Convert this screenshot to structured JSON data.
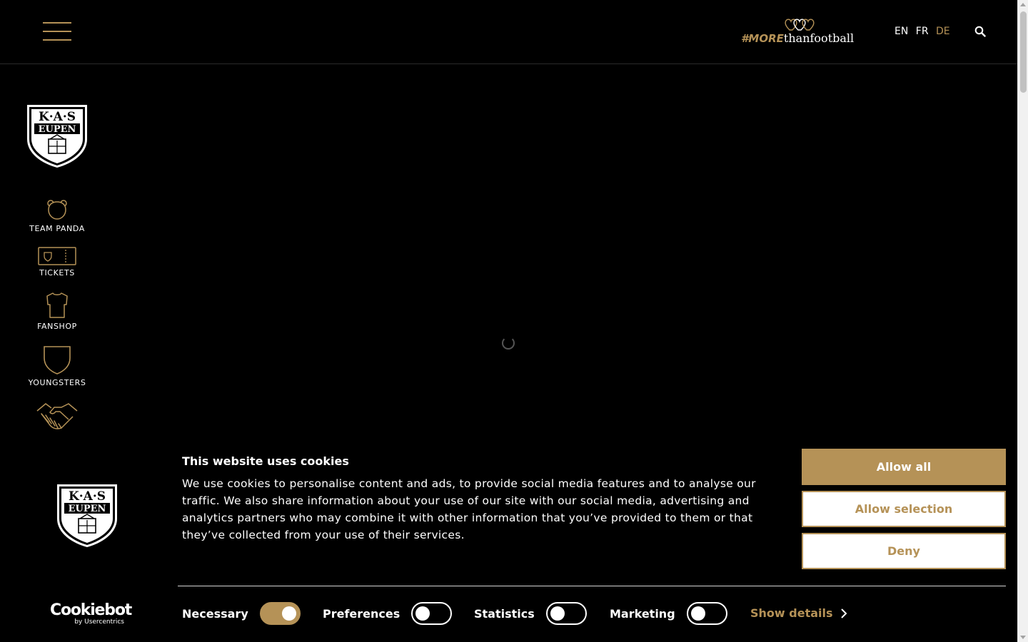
{
  "header": {
    "claim_hash": "#MORE",
    "claim_rest": "thanfootball",
    "languages": [
      {
        "code": "EN",
        "active": false
      },
      {
        "code": "FR",
        "active": false
      },
      {
        "code": "DE",
        "active": true
      }
    ]
  },
  "sidebar": {
    "crest_text_top": "K·A·S",
    "crest_text_bottom": "EUPEN",
    "items": [
      {
        "label": "TEAM PANDA",
        "icon": "panda-icon"
      },
      {
        "label": "TICKETS",
        "icon": "ticket-icon"
      },
      {
        "label": "FANSHOP",
        "icon": "shirt-icon"
      },
      {
        "label": "YOUNGSTERS",
        "icon": "shield-icon"
      },
      {
        "label": "",
        "icon": "handshake-icon"
      }
    ]
  },
  "cookie": {
    "title": "This website uses cookies",
    "body": "We use cookies to personalise content and ads, to provide social media features and to analyse our traffic. We also share information about your use of our site with our social media, advertising and analytics partners who may combine it with other information that you’ve provided to them or that they’ve collected from your use of their services.",
    "buttons": {
      "allow_all": "Allow all",
      "allow_selection": "Allow selection",
      "deny": "Deny"
    },
    "toggles": [
      {
        "label": "Necessary",
        "on": true
      },
      {
        "label": "Preferences",
        "on": false
      },
      {
        "label": "Statistics",
        "on": false
      },
      {
        "label": "Marketing",
        "on": false
      }
    ],
    "show_details": "Show details",
    "brand_main": "Cookiebot",
    "brand_sub": "by Usercentrics"
  },
  "colors": {
    "accent": "#b59257",
    "background": "#000000",
    "text": "#ffffff"
  }
}
